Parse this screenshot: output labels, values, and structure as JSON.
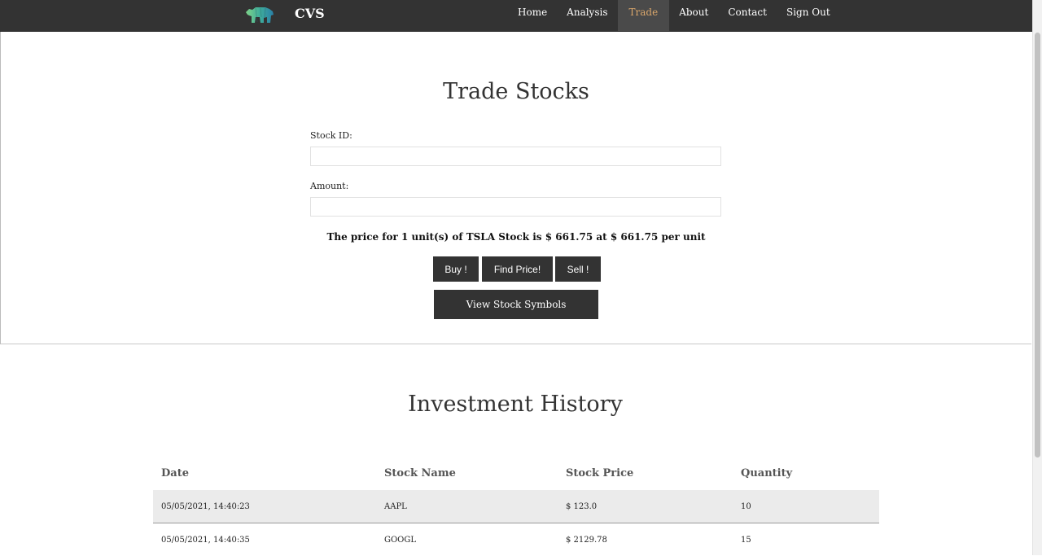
{
  "nav": {
    "brand": "CVS",
    "items": [
      {
        "label": "Home",
        "active": false
      },
      {
        "label": "Analysis",
        "active": false
      },
      {
        "label": "Trade",
        "active": true
      },
      {
        "label": "About",
        "active": false
      },
      {
        "label": "Contact",
        "active": false
      },
      {
        "label": "Sign Out",
        "active": false
      }
    ]
  },
  "trade": {
    "title": "Trade Stocks",
    "stock_id_label": "Stock ID:",
    "stock_id_value": "",
    "amount_label": "Amount:",
    "amount_value": "",
    "price_message": "The price for 1 unit(s) of TSLA Stock is $ 661.75 at $ 661.75 per unit",
    "buttons": {
      "buy": "Buy !",
      "find": "Find Price!",
      "sell": "Sell !",
      "view": "View Stock Symbols"
    }
  },
  "history": {
    "title": "Investment History",
    "columns": [
      "Date",
      "Stock Name",
      "Stock Price",
      "Quantity"
    ],
    "rows": [
      [
        "05/05/2021, 14:40:23",
        "AAPL",
        "$ 123.0",
        "10"
      ],
      [
        "05/05/2021, 14:40:35",
        "GOOGL",
        "$ 2129.78",
        "15"
      ]
    ]
  },
  "colors": {
    "nav_bg": "#333333",
    "active_link": "#d9a66b",
    "button_bg": "#333333",
    "row_highlight": "#ebebeb"
  }
}
